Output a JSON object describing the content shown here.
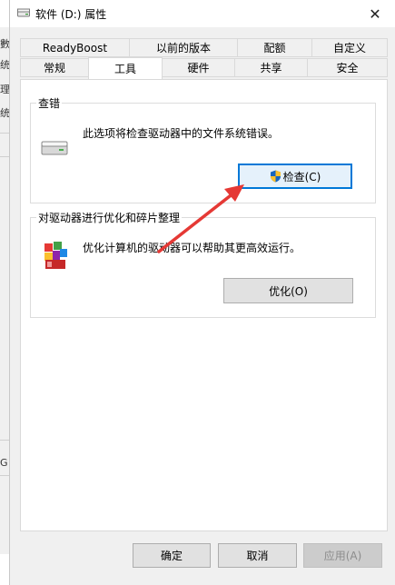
{
  "window": {
    "title": "软件 (D:) 属性",
    "close_glyph": "✕"
  },
  "background": {
    "glyphs": [
      "數",
      "统",
      "理",
      "统",
      "G"
    ]
  },
  "tabs": {
    "row_back": [
      "ReadyBoost",
      "以前的版本",
      "配额",
      "自定义"
    ],
    "row_front": [
      "常规",
      "工具",
      "硬件",
      "共享",
      "安全"
    ],
    "active": "工具"
  },
  "error_check": {
    "title": "查错",
    "description": "此选项将检查驱动器中的文件系统错误。",
    "button_label": "检查(C)"
  },
  "optimize": {
    "title": "对驱动器进行优化和碎片整理",
    "description": "优化计算机的驱动器可以帮助其更高效运行。",
    "button_label": "优化(O)"
  },
  "footer": {
    "ok_label": "确定",
    "cancel_label": "取消",
    "apply_label": "应用(A)"
  },
  "colors": {
    "accent": "#0078d7",
    "annotation_arrow": "#e53935"
  }
}
